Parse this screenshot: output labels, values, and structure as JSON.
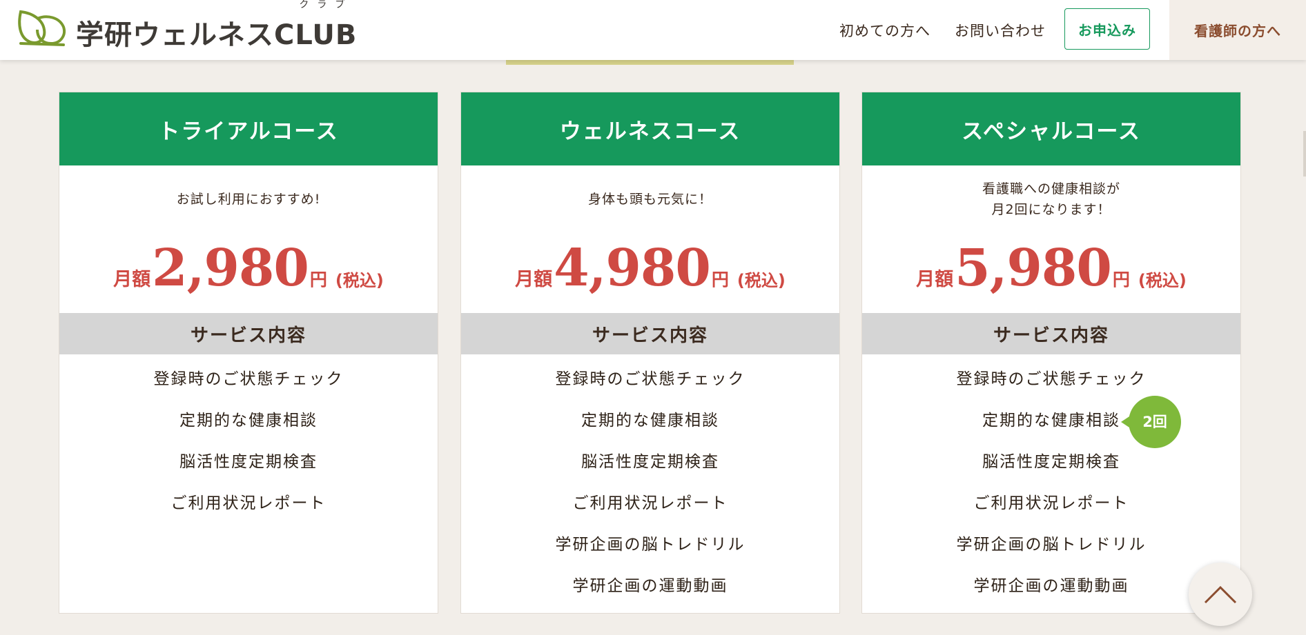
{
  "header": {
    "logo": {
      "text": "学研ウェルネスCLUB",
      "ruby": "クラブ",
      "icon": "leaf-logo-icon"
    },
    "nav": {
      "first_visit": "初めての方へ",
      "contact": "お問い合わせ",
      "apply": "お申込み",
      "nurses": "看護師の方へ"
    }
  },
  "colors": {
    "accent_green": "#16995c",
    "price_red": "#cf4a43",
    "badge_green": "#7fb93a",
    "brown_text": "#8b4d2f"
  },
  "plans": [
    {
      "name": "トライアルコース",
      "tagline": [
        "お試し利用におすすめ!"
      ],
      "price": {
        "label": "月額",
        "amount": "2,980",
        "unit": "円",
        "tax": "(税込)"
      },
      "services_heading": "サービス内容",
      "services": [
        "登録時のご状態チェック",
        "定期的な健康相談",
        "脳活性度定期検査",
        "ご利用状況レポート"
      ]
    },
    {
      "name": "ウェルネスコース",
      "tagline": [
        "身体も頭も元気に！"
      ],
      "price": {
        "label": "月額",
        "amount": "4,980",
        "unit": "円",
        "tax": "(税込)"
      },
      "services_heading": "サービス内容",
      "services": [
        "登録時のご状態チェック",
        "定期的な健康相談",
        "脳活性度定期検査",
        "ご利用状況レポート",
        "学研企画の脳トレドリル",
        "学研企画の運動動画"
      ]
    },
    {
      "name": "スペシャルコース",
      "tagline": [
        "看護職への健康相談が",
        "月2回になります！"
      ],
      "price": {
        "label": "月額",
        "amount": "5,980",
        "unit": "円",
        "tax": "(税込)"
      },
      "services_heading": "サービス内容",
      "services": [
        "登録時のご状態チェック",
        "定期的な健康相談",
        "脳活性度定期検査",
        "ご利用状況レポート",
        "学研企画の脳トレドリル",
        "学研企画の運動動画"
      ],
      "badge": "2回"
    }
  ],
  "scroll_top_icon": "chevron-up-icon"
}
